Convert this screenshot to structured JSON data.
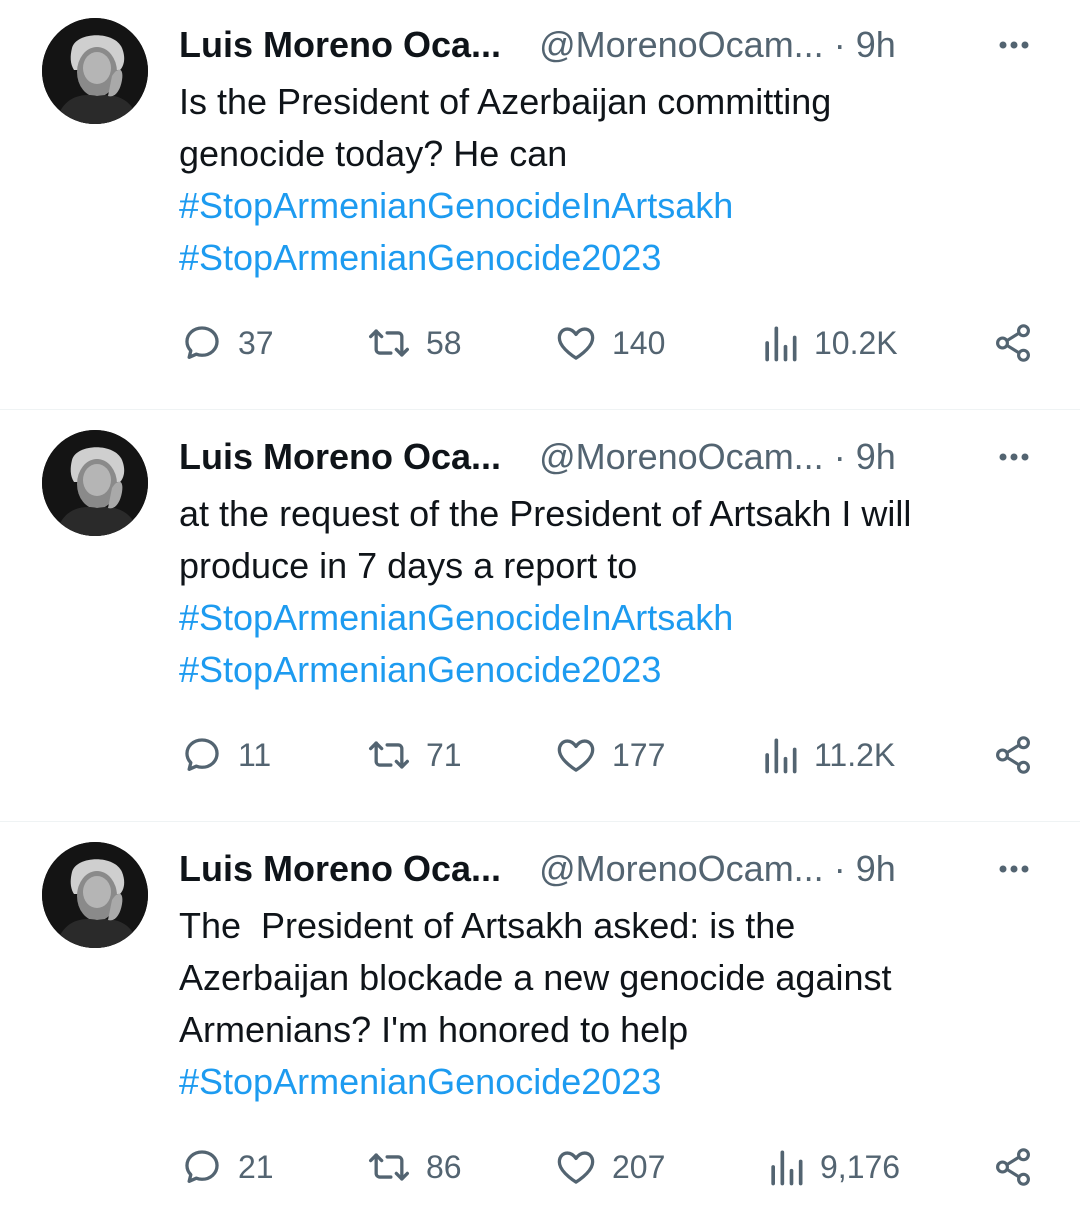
{
  "colors": {
    "text": "#0f1419",
    "muted": "#536471",
    "link": "#1d9bf0",
    "divider": "#eff3f4"
  },
  "icons": {
    "reply": "reply-icon",
    "retweet": "retweet-icon",
    "like": "heart-icon",
    "views": "views-bar-chart-icon",
    "share": "share-icon",
    "more": "more-dots-icon"
  },
  "tweets": [
    {
      "name": "Luis Moreno Oca...",
      "handle": "@MorenoOcam...",
      "sep": "·",
      "time": "9h",
      "lines": [
        "Is the President of Azerbaijan committing",
        "genocide today? He can"
      ],
      "hashtags": [
        "#StopArmenianGenocideInArtsakh",
        "#StopArmenianGenocide2023"
      ],
      "replies": "37",
      "retweets": "58",
      "likes": "140",
      "views": "10.2K"
    },
    {
      "name": "Luis Moreno Oca...",
      "handle": "@MorenoOcam...",
      "sep": "·",
      "time": "9h",
      "lines": [
        "at the request of the President of Artsakh I will",
        "produce in 7 days a report to"
      ],
      "hashtags": [
        "#StopArmenianGenocideInArtsakh",
        "#StopArmenianGenocide2023"
      ],
      "replies": "11",
      "retweets": "71",
      "likes": "177",
      "views": "11.2K"
    },
    {
      "name": "Luis Moreno Oca...",
      "handle": "@MorenoOcam...",
      "sep": "·",
      "time": "9h",
      "lines": [
        "The  President of Artsakh asked: is the",
        "Azerbaijan blockade a new genocide against",
        "Armenians? I'm honored to help"
      ],
      "hashtags": [
        "#StopArmenianGenocide2023"
      ],
      "replies": "21",
      "retweets": "86",
      "likes": "207",
      "views": "9,176"
    }
  ]
}
